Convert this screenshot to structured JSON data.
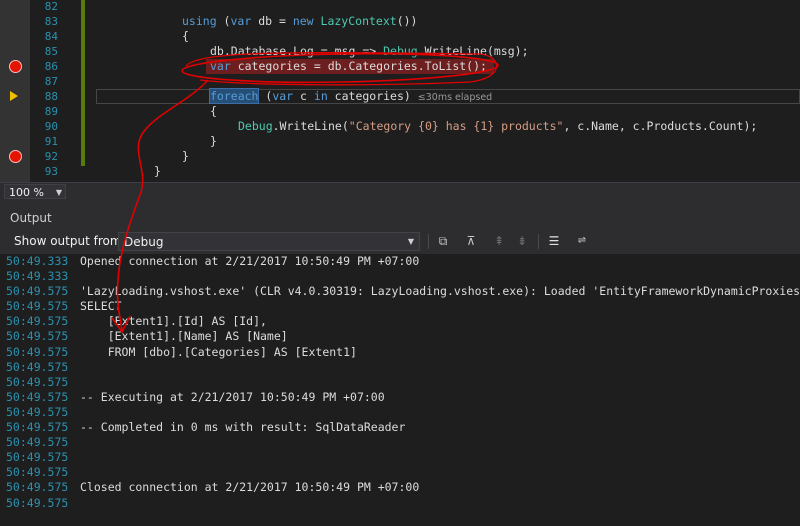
{
  "editor": {
    "lines": [
      {
        "num": "82",
        "text": ""
      },
      {
        "num": "83",
        "parts": [
          {
            "t": "using",
            "c": "kw"
          },
          {
            "t": " (",
            "c": ""
          },
          {
            "t": "var",
            "c": "kw"
          },
          {
            "t": " db = ",
            "c": ""
          },
          {
            "t": "new",
            "c": "kw"
          },
          {
            "t": " ",
            "c": ""
          },
          {
            "t": "LazyContext",
            "c": "ty"
          },
          {
            "t": "())",
            "c": ""
          }
        ],
        "indent": 86
      },
      {
        "num": "84",
        "parts": [
          {
            "t": "{",
            "c": ""
          }
        ],
        "indent": 86
      },
      {
        "num": "85",
        "parts": [
          {
            "t": "db.Database.Log = msg => ",
            "c": ""
          },
          {
            "t": "Debug",
            "c": "ty"
          },
          {
            "t": ".WriteLine(msg);",
            "c": ""
          }
        ],
        "indent": 114
      },
      {
        "num": "86",
        "parts": [
          {
            "t": "var",
            "c": "kw"
          },
          {
            "t": " categories = db.Categories.ToList();",
            "c": ""
          }
        ],
        "indent": 114,
        "breakpoint": true
      },
      {
        "num": "87",
        "text": ""
      },
      {
        "num": "88",
        "parts": [
          {
            "t": "foreach",
            "c": "kw foreach-hl"
          },
          {
            "t": " (",
            "c": ""
          },
          {
            "t": "var",
            "c": "kw"
          },
          {
            "t": " c ",
            "c": ""
          },
          {
            "t": "in",
            "c": "kw"
          },
          {
            "t": " categories) ",
            "c": ""
          },
          {
            "t": "≤30ms elapsed",
            "c": "elapsed"
          }
        ],
        "indent": 114,
        "current": true
      },
      {
        "num": "89",
        "parts": [
          {
            "t": "{",
            "c": ""
          }
        ],
        "indent": 114
      },
      {
        "num": "90",
        "parts": [
          {
            "t": "Debug",
            "c": "ty"
          },
          {
            "t": ".WriteLine(",
            "c": ""
          },
          {
            "t": "\"Category {0} has {1} products\"",
            "c": "st"
          },
          {
            "t": ", c.Name, c.Products.Count);",
            "c": ""
          }
        ],
        "indent": 142
      },
      {
        "num": "91",
        "parts": [
          {
            "t": "}",
            "c": ""
          }
        ],
        "indent": 114
      },
      {
        "num": "92",
        "parts": [
          {
            "t": "}",
            "c": ""
          }
        ],
        "indent": 86,
        "breakpoint": true
      },
      {
        "num": "93",
        "parts": [
          {
            "t": "}",
            "c": ""
          }
        ],
        "indent": 58
      }
    ]
  },
  "zoom": {
    "value": "100 %"
  },
  "output_panel": {
    "title": "Output",
    "show_output_from_label": "Show output from:",
    "source": "Debug",
    "lines": [
      {
        "ts": "50:49.333",
        "text": "Opened connection at 2/21/2017 10:50:49 PM +07:00"
      },
      {
        "ts": "50:49.333",
        "text": ""
      },
      {
        "ts": "50:49.575",
        "text": "'LazyLoading.vshost.exe' (CLR v4.0.30319: LazyLoading.vshost.exe): Loaded 'EntityFrameworkDynamicProxies"
      },
      {
        "ts": "50:49.575",
        "text": "SELECT"
      },
      {
        "ts": "50:49.575",
        "text": "    [Extent1].[Id] AS [Id],"
      },
      {
        "ts": "50:49.575",
        "text": "    [Extent1].[Name] AS [Name]"
      },
      {
        "ts": "50:49.575",
        "text": "    FROM [dbo].[Categories] AS [Extent1]"
      },
      {
        "ts": "50:49.575",
        "text": ""
      },
      {
        "ts": "50:49.575",
        "text": ""
      },
      {
        "ts": "50:49.575",
        "text": "-- Executing at 2/21/2017 10:50:49 PM +07:00"
      },
      {
        "ts": "50:49.575",
        "text": ""
      },
      {
        "ts": "50:49.575",
        "text": "-- Completed in 0 ms with result: SqlDataReader"
      },
      {
        "ts": "50:49.575",
        "text": ""
      },
      {
        "ts": "50:49.575",
        "text": ""
      },
      {
        "ts": "50:49.575",
        "text": ""
      },
      {
        "ts": "50:49.575",
        "text": "Closed connection at 2/21/2017 10:50:49 PM +07:00"
      },
      {
        "ts": "50:49.575",
        "text": ""
      }
    ]
  },
  "icons": {
    "find_message": "find-in-output-icon",
    "prev_message": "previous-message-icon",
    "next_message": "next-message-icon",
    "goto_prev": "go-to-previous-icon",
    "goto_next": "go-to-next-icon",
    "clear_all": "clear-all-icon",
    "word_wrap": "toggle-word-wrap-icon"
  },
  "colors": {
    "breakpoint": "#e51400",
    "annotation_ink": "#e00000",
    "keyword": "#569cd6",
    "type": "#4ec9b0",
    "string": "#d69d85",
    "line_number": "#2b91af"
  }
}
